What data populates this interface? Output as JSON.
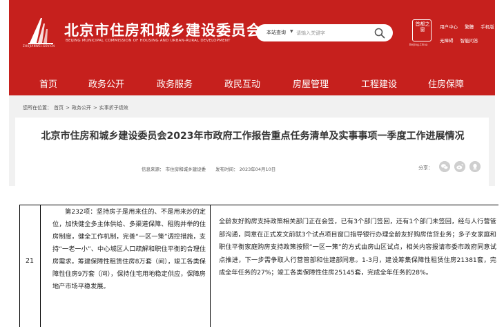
{
  "header": {
    "logo_caption": "ZHUJIANWEI.GOV.CN",
    "title": "北京市住房和城乡建设委员会",
    "subtitle": "BEIJING MUNICIPAL COMMISSION OF HOUSING AND URBAN-RURAL DEVELOPMENT",
    "emblem_text": "首都之窗",
    "emblem_caption": "Beijing.China",
    "brand_color": "#c6201d"
  },
  "search": {
    "scope": "本站查询",
    "placeholder": "请输入关键字"
  },
  "tools": {
    "row1": [
      "用户中心",
      "繁體",
      "手机版"
    ],
    "row2": [
      "无障碍",
      "智能问答"
    ]
  },
  "nav": {
    "items": [
      "首页",
      "政务公开",
      "政务服务",
      "政民互动",
      "房屋管理",
      "工程建设",
      "住房保障"
    ]
  },
  "breadcrumb": {
    "prefix": "您所在位置：",
    "items": [
      "首页",
      "政务公开",
      "实事折子绩效"
    ],
    "separator": ">"
  },
  "article": {
    "title": "北京市住房和城乡建设委员会2023年市政府工作报告重点任务清单及实事事项一季度工作进展情况",
    "source": "信息来源：  市住房和城乡建设委",
    "date": "发布时间：  2023年04月10日",
    "share_label": "分享："
  },
  "table": {
    "number": "21",
    "task": "第232项：坚持房子是用来住的、不是用来炒的定位，加快健全多主体供给、多渠道保障、租购并举的住房制度，健全工作机制，完善“一区一策”调控措施，支持“一老一小”、中心城区人口疏解和职住平衡的合理住房需求。筹建保障性租赁住房8万套（间），竣工各类保障性住房9万套（间），保持住宅用地稳定供应，保障房地产市场平稳发展。",
    "progress": "全龄友好购房支持政策相关部门正在会签，已有3个部门签回，还有1个部门未签回，经与人行营管部沟通，同意在正式发文前就3个试点项目窗口指导银行办理全龄友好购房信贷业务；多子女家庭和职住平衡家庭购房支持政策按照“一区一策”的方式由房山区试点，相关内容报请市委市政府同意试点推进，下一步需争取人行营管部和住建部同意。1-3月，建设筹集保障性租赁住房21381套，完成全年任务的27%；竣工各类保障性住房25145套，完成全年任务的28%。"
  }
}
